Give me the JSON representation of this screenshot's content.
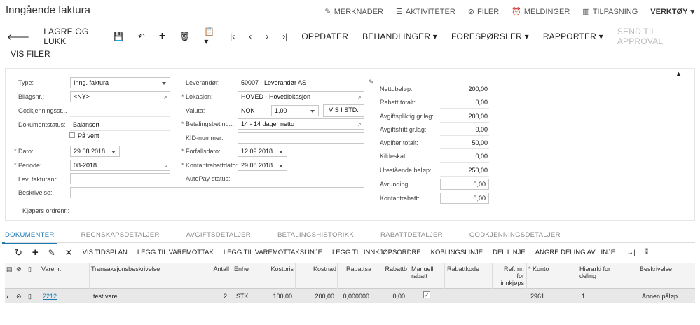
{
  "title": "Inngående faktura",
  "toplinks": {
    "merknader": "MERKNADER",
    "aktiviteter": "AKTIVITETER",
    "filer": "FILER",
    "meldinger": "MELDINGER",
    "tilpasning": "TILPASNING",
    "verktoy": "VERKTØY"
  },
  "toolbar": {
    "lagre": "LAGRE OG LUKK",
    "oppdater": "OPPDATER",
    "behandlinger": "BEHANDLINGER",
    "foresporsler": "FORESPØRSLER",
    "rapporter": "RAPPORTER",
    "send": "SEND TIL APPROVAL",
    "visfiler": "VIS FILER"
  },
  "form": {
    "type_lbl": "Type:",
    "type_val": "Inng. faktura",
    "bilag_lbl": "Bilagsnr.:",
    "bilag_val": "<NY>",
    "godkj_lbl": "Godkjenningsst...",
    "dokstatus_lbl": "Dokumentstatus:",
    "dokstatus_val": "Balansert",
    "paavent": "På vent",
    "dato_lbl": "Dato:",
    "dato_val": "29.08.2018",
    "periode_lbl": "Periode:",
    "periode_val": "08-2018",
    "levfaktura_lbl": "Lev. fakturanr:",
    "beskrivelse_lbl": "Beskrivelse:",
    "kjopers_lbl": "Kjøpers ordrenr.:",
    "leverandor_lbl": "Leverandør:",
    "leverandor_val": "50007 - Leverandør AS",
    "lokasjon_lbl": "Lokasjon:",
    "lokasjon_val": "HOVED - Hovedlokasjon",
    "valuta_lbl": "Valuta:",
    "valuta_val": "NOK",
    "kurs_val": "1,00",
    "visistd": "VIS I STD.",
    "betaling_lbl": "Betalingsbeting...",
    "betaling_val": "14 - 14 dager netto",
    "kid_lbl": "KID-nummer:",
    "forfall_lbl": "Forfallsdato:",
    "forfall_val": "12.09.2018",
    "kontant_lbl": "Kontantrabattdato:",
    "kontant_val": "29.08.2018",
    "autopay_lbl": "AutoPay-status:"
  },
  "totals": [
    {
      "label": "Nettobeløp:",
      "value": "200,00"
    },
    {
      "label": "Rabatt totalt:",
      "value": "0,00"
    },
    {
      "label": "Avgiftspliktig gr.lag:",
      "value": "200,00"
    },
    {
      "label": "Avgiftsfritt gr.lag:",
      "value": "0,00"
    },
    {
      "label": "Avgifter totalt:",
      "value": "50,00"
    },
    {
      "label": "Kildeskatt:",
      "value": "0,00"
    },
    {
      "label": "Utestående beløp:",
      "value": "250,00"
    },
    {
      "label": "Avrunding:",
      "value": "0,00"
    },
    {
      "label": "Kontantrabatt:",
      "value": "0,00"
    }
  ],
  "tabs": [
    "DOKUMENTER",
    "REGNSKAPSDETALJER",
    "AVGIFTSDETALJER",
    "BETALINGSHISTORIKK",
    "RABATTDETALJER",
    "GODKJENNINGSDETALJER"
  ],
  "gridtb": [
    "VIS TIDSPLAN",
    "LEGG TIL VAREMOTTAK",
    "LEGG TIL VAREMOTTAKSLINJE",
    "LEGG TIL INNKJØPSORDRE",
    "KOBLINGSLINJE",
    "DEL LINJE",
    "ANGRE DELING AV LINJE"
  ],
  "columns": {
    "varenr": "Varenr.",
    "transbesk": "Transaksjonsbeskrivelse",
    "antall": "Antall",
    "enhet": "Enhe",
    "kostpris": "Kostpris",
    "kostnad": "Kostnad",
    "rabattsats": "Rabattsa",
    "rabattbelop": "Rabattb",
    "manuell": "Manuell rabatt",
    "rabattkode": "Rabattkode",
    "refnr": "Ref. nr. for innkjøps",
    "konto": "Konto",
    "hierarki": "Hierarki for deling",
    "beskrivelse": "Beskrivelse"
  },
  "row": {
    "varenr": "2212",
    "transbesk": "test vare",
    "antall": "2",
    "enhet": "STK",
    "kostpris": "100,00",
    "kostnad": "200,00",
    "rabattsats": "0,000000",
    "rabattbelop": "0,00",
    "konto": "2961",
    "hierarki": "1",
    "beskrivelse": "Annen påløp..."
  }
}
